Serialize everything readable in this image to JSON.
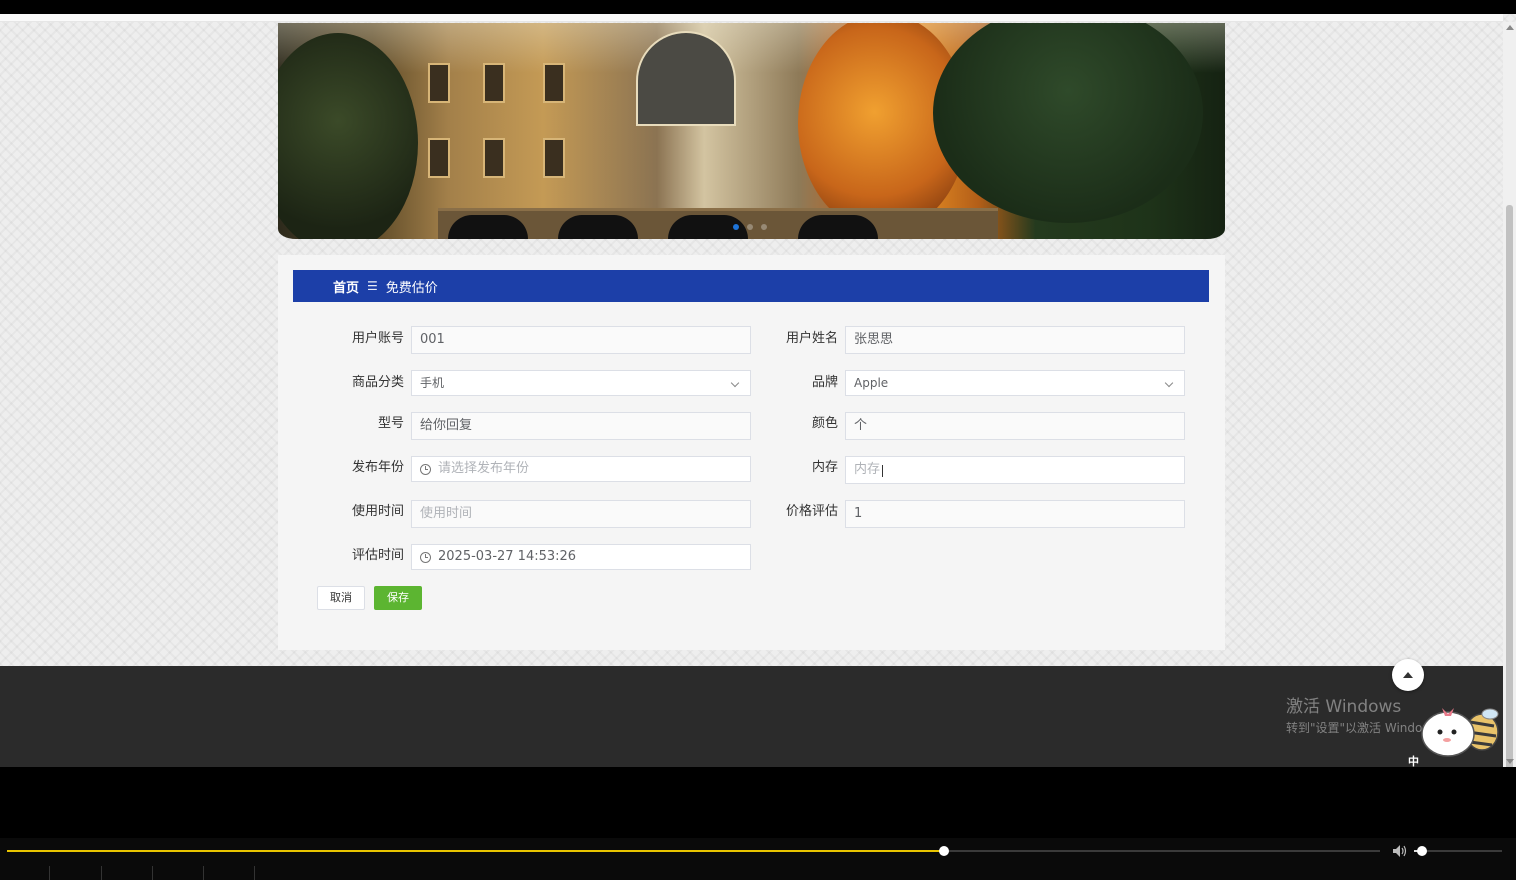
{
  "breadcrumb": {
    "home": "首页",
    "separator": "☰",
    "current": "免费估价"
  },
  "form": {
    "user_account": {
      "label": "用户账号",
      "value": "001"
    },
    "user_name": {
      "label": "用户姓名",
      "value": "张思思"
    },
    "category": {
      "label": "商品分类",
      "value": "手机"
    },
    "brand": {
      "label": "品牌",
      "value": "Apple"
    },
    "model": {
      "label": "型号",
      "value": "给你回复"
    },
    "color": {
      "label": "颜色",
      "value": "个"
    },
    "release_year": {
      "label": "发布年份",
      "placeholder": "请选择发布年份"
    },
    "memory": {
      "label": "内存",
      "placeholder": "内存"
    },
    "usage_time": {
      "label": "使用时间",
      "placeholder": "使用时间"
    },
    "price_estimate": {
      "label": "价格评估",
      "value": "1"
    },
    "eval_time": {
      "label": "评估时间",
      "value": "2025-03-27 14:53:26"
    }
  },
  "buttons": {
    "cancel": "取消",
    "save": "保存"
  },
  "carousel": {
    "slide_count": 3,
    "active_index": 0
  },
  "watermark": {
    "line1": "激活 Windows",
    "line2": "转到\"设置\"以激活 Windows。"
  },
  "ime": {
    "label": "中"
  },
  "player": {
    "progress": 0.6825,
    "volume": 0.09
  },
  "colors": {
    "breadcrumb_bg": "#1c3fa8",
    "save_bg": "#5cb531",
    "progress": "#e8c400",
    "footer_bg": "#2b2b2b"
  },
  "icons": {
    "clock": "clock-icon",
    "chevron": "chevron-down-icon",
    "to_top": "arrow-up-icon",
    "volume": "speaker-icon"
  }
}
